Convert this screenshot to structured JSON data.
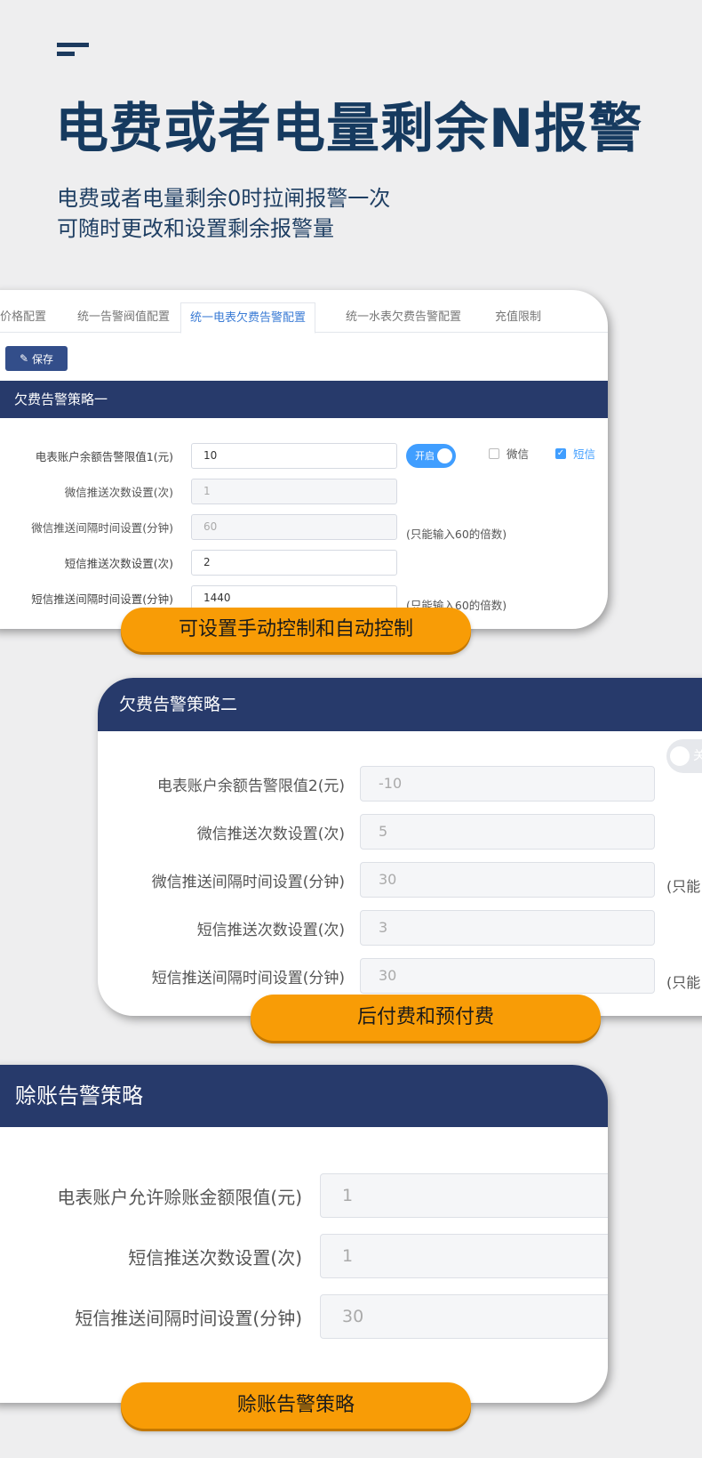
{
  "header": {
    "title": "电费或者电量剩余N报警",
    "line1": "电费或者电量剩余0时拉闸报警一次",
    "line2": "可随时更改和设置剩余报警量"
  },
  "card1": {
    "tabs": [
      "价格配置",
      "统一告警阀值配置",
      "统一电表欠费告警配置",
      "统一水表欠费告警配置",
      "充值限制"
    ],
    "active_tab": 2,
    "save_label": "保存",
    "section_title": "欠费告警策略一",
    "toggle_label": "开启",
    "channels": [
      {
        "label": "微信",
        "checked": false
      },
      {
        "label": "短信",
        "checked": true
      }
    ],
    "rows": [
      {
        "label": "电表账户余额告警限值1(元)",
        "value": "10",
        "disabled": false,
        "hint": ""
      },
      {
        "label": "微信推送次数设置(次)",
        "value": "1",
        "disabled": true,
        "hint": ""
      },
      {
        "label": "微信推送间隔时间设置(分钟)",
        "value": "60",
        "disabled": true,
        "hint": "(只能输入60的倍数)"
      },
      {
        "label": "短信推送次数设置(次)",
        "value": "2",
        "disabled": false,
        "hint": ""
      },
      {
        "label": "短信推送间隔时间设置(分钟)",
        "value": "1440",
        "disabled": false,
        "hint": "(只能输入60的倍数)"
      }
    ],
    "caption": "可设置手动控制和自动控制"
  },
  "card2": {
    "section_title": "欠费告警策略二",
    "toggle_label": "关",
    "rows": [
      {
        "label": "电表账户余额告警限值2(元)",
        "value": "-10",
        "hint": ""
      },
      {
        "label": "微信推送次数设置(次)",
        "value": "5",
        "hint": ""
      },
      {
        "label": "微信推送间隔时间设置(分钟)",
        "value": "30",
        "hint": "(只能"
      },
      {
        "label": "短信推送次数设置(次)",
        "value": "3",
        "hint": ""
      },
      {
        "label": "短信推送间隔时间设置(分钟)",
        "value": "30",
        "hint": "(只能"
      }
    ],
    "caption": "后付费和预付费"
  },
  "card3": {
    "section_title": "赊账告警策略",
    "rows": [
      {
        "label": "电表账户允许赊账金额限值(元)",
        "value": "1"
      },
      {
        "label": "短信推送次数设置(次)",
        "value": "1"
      },
      {
        "label": "短信推送间隔时间设置(分钟)",
        "value": "30"
      }
    ],
    "caption": "赊账告警策略"
  },
  "colors": {
    "navy": "#273a6b",
    "accent_blue": "#409eff",
    "pill_orange": "#f89c06",
    "title_blue": "#163a5f"
  }
}
